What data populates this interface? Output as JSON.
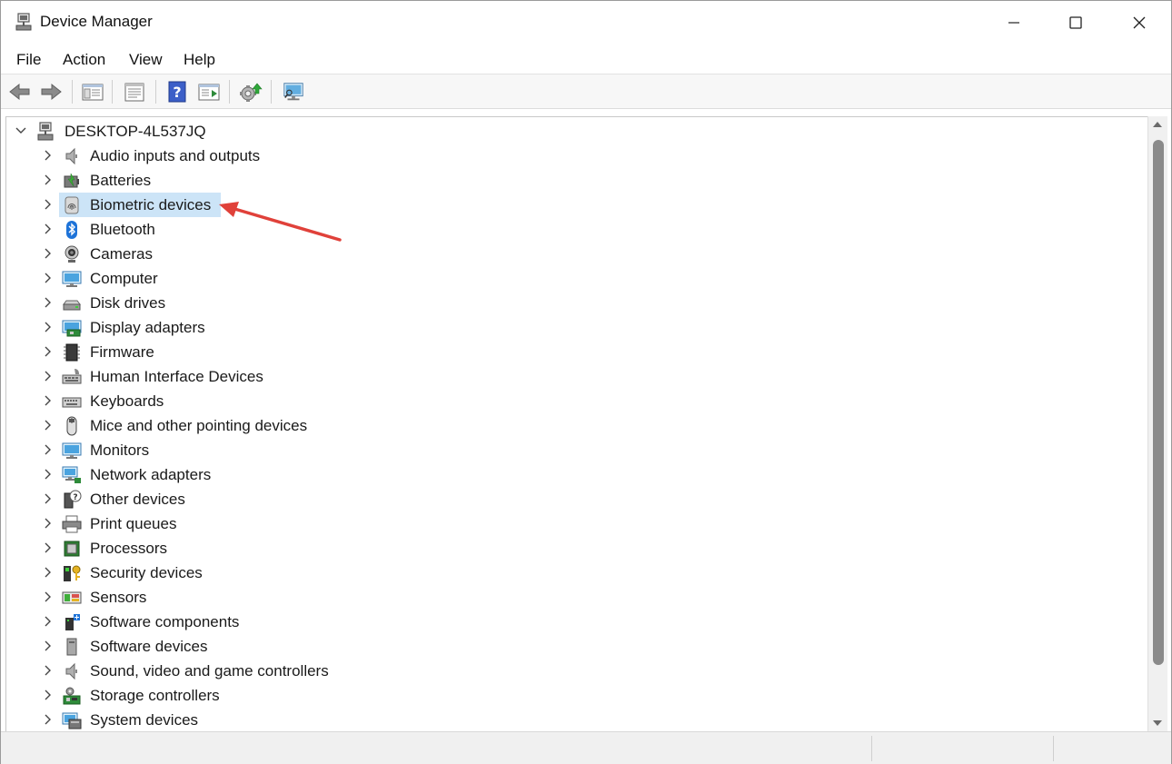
{
  "window": {
    "title": "Device Manager",
    "controls": [
      "minimize",
      "maximize",
      "close"
    ]
  },
  "menu": {
    "items": [
      "File",
      "Action",
      "View",
      "Help"
    ]
  },
  "toolbar": {
    "buttons": [
      "back-arrow-icon",
      "forward-arrow-icon",
      "show-hide-console-tree-icon",
      "properties-icon",
      "help-icon",
      "action-pane-icon",
      "update-driver-icon",
      "scan-hardware-changes-icon"
    ]
  },
  "tree": {
    "root": "DESKTOP-4L537JQ",
    "selected_index": 2,
    "categories": [
      {
        "label": "Audio inputs and outputs",
        "icon": "speaker-icon"
      },
      {
        "label": "Batteries",
        "icon": "battery-icon"
      },
      {
        "label": "Biometric devices",
        "icon": "fingerprint-icon"
      },
      {
        "label": "Bluetooth",
        "icon": "bluetooth-icon"
      },
      {
        "label": "Cameras",
        "icon": "camera-icon"
      },
      {
        "label": "Computer",
        "icon": "computer-icon"
      },
      {
        "label": "Disk drives",
        "icon": "disk-drive-icon"
      },
      {
        "label": "Display adapters",
        "icon": "display-adapter-icon"
      },
      {
        "label": "Firmware",
        "icon": "firmware-chip-icon"
      },
      {
        "label": "Human Interface Devices",
        "icon": "hid-icon"
      },
      {
        "label": "Keyboards",
        "icon": "keyboard-icon"
      },
      {
        "label": "Mice and other pointing devices",
        "icon": "mouse-icon"
      },
      {
        "label": "Monitors",
        "icon": "monitor-icon"
      },
      {
        "label": "Network adapters",
        "icon": "network-adapter-icon"
      },
      {
        "label": "Other devices",
        "icon": "unknown-device-icon"
      },
      {
        "label": "Print queues",
        "icon": "printer-icon"
      },
      {
        "label": "Processors",
        "icon": "processor-icon"
      },
      {
        "label": "Security devices",
        "icon": "security-key-icon"
      },
      {
        "label": "Sensors",
        "icon": "sensor-icon"
      },
      {
        "label": "Software components",
        "icon": "software-component-icon"
      },
      {
        "label": "Software devices",
        "icon": "software-device-icon"
      },
      {
        "label": "Sound, video and game controllers",
        "icon": "sound-controller-icon"
      },
      {
        "label": "Storage controllers",
        "icon": "storage-controller-icon"
      },
      {
        "label": "System devices",
        "icon": "system-devices-icon"
      }
    ]
  },
  "annotation": {
    "type": "arrow",
    "color": "#e0413a",
    "points_to": "Biometric devices"
  },
  "colors": {
    "selection": "#cce4f7",
    "scroll_thumb": "#8a8a8a"
  }
}
